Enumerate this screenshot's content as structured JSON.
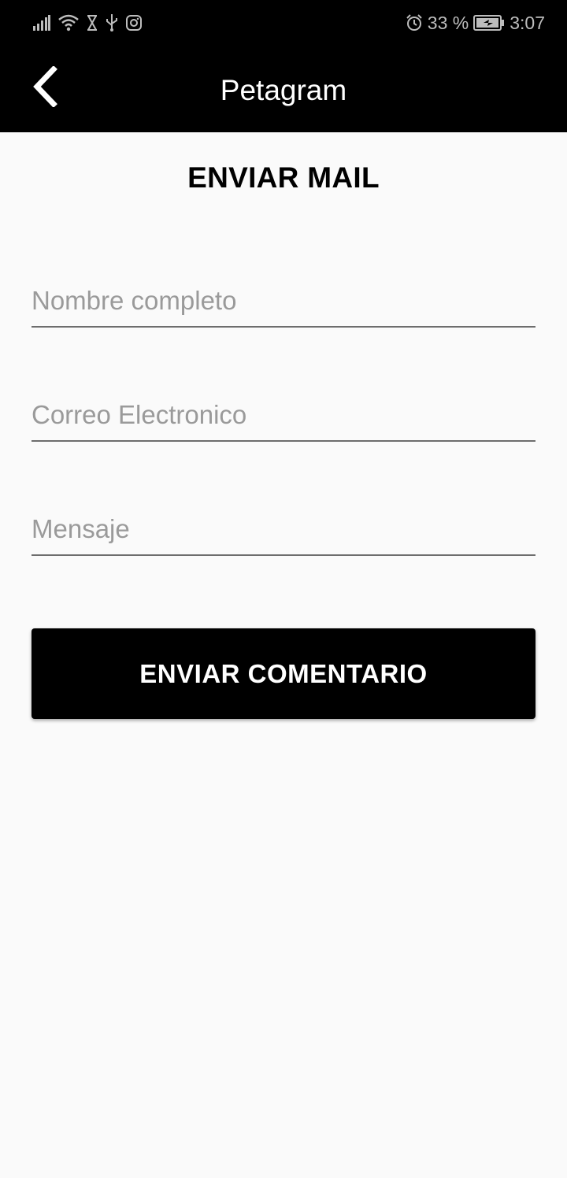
{
  "status_bar": {
    "battery_percent": "33 %",
    "battery_level": 0.33,
    "time": "3:07",
    "icons_left": [
      "signal-icon",
      "wifi-icon",
      "hourglass-icon",
      "usb-icon",
      "instagram-icon"
    ],
    "icons_right": [
      "alarm-icon",
      "battery-charging-icon"
    ]
  },
  "app_bar": {
    "title": "Petagram",
    "back_icon": "chevron-left-icon"
  },
  "page": {
    "title": "ENVIAR MAIL"
  },
  "form": {
    "name_placeholder": "Nombre completo",
    "name_value": "",
    "email_placeholder": "Correo Electronico",
    "email_value": "",
    "message_placeholder": "Mensaje",
    "message_value": "",
    "submit_label": "ENVIAR COMENTARIO"
  },
  "colors": {
    "app_bar_bg": "#000000",
    "background": "#fafafa",
    "button_bg": "#000000",
    "button_text": "#ffffff",
    "placeholder": "#9a9a9a"
  }
}
